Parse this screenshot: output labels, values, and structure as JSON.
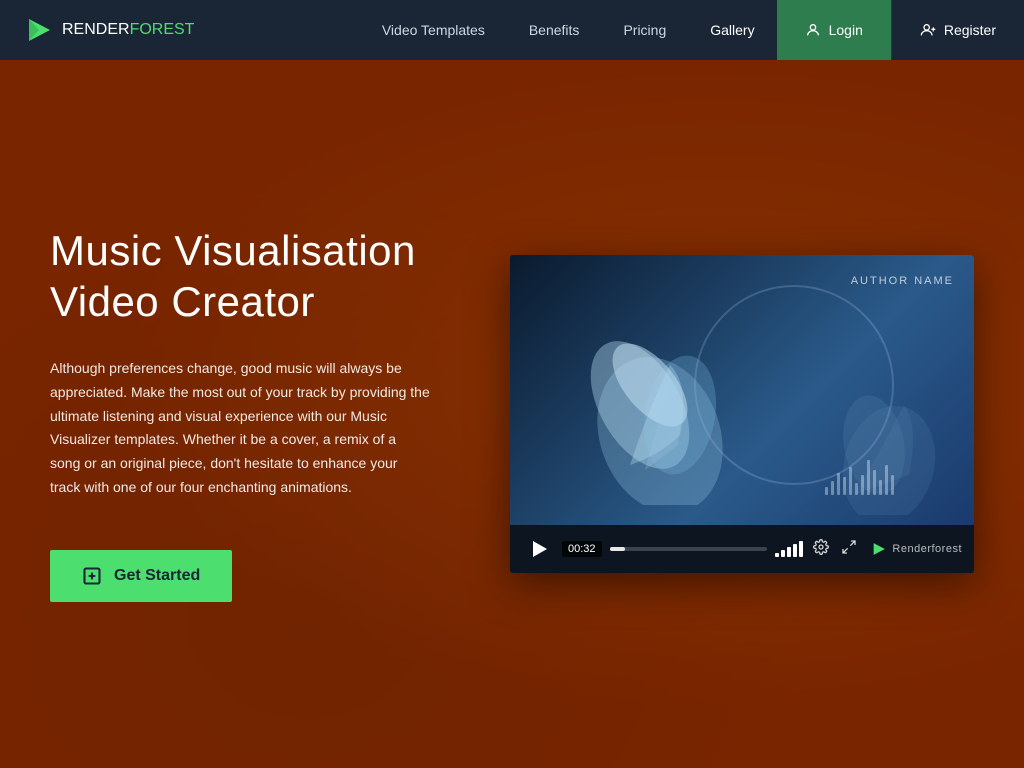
{
  "brand": {
    "name_part1": "RENDER",
    "name_part2": "FOREST"
  },
  "nav": {
    "links": [
      {
        "label": "Video Templates",
        "active": false
      },
      {
        "label": "Benefits",
        "active": false
      },
      {
        "label": "Pricing",
        "active": false
      },
      {
        "label": "Gallery",
        "active": true
      }
    ],
    "login_label": "Login",
    "register_label": "Register"
  },
  "hero": {
    "title": "Music Visualisation\nVideo Creator",
    "description": "Although preferences change, good music will always be appreciated. Make the most out of your track by providing the ultimate listening and visual experience with our Music Visualizer templates. Whether it be a cover, a remix of a song or an original piece, don't hesitate to enhance your track with one of our four enchanting animations.",
    "cta_label": "Get Started"
  },
  "video": {
    "author_name": "AUTHOR NAME",
    "timestamp": "00:32",
    "watermark": "Renderforest"
  },
  "colors": {
    "green_accent": "#4cde6e",
    "dark_navy": "#1a2535",
    "login_bg": "#2e7d4f"
  }
}
